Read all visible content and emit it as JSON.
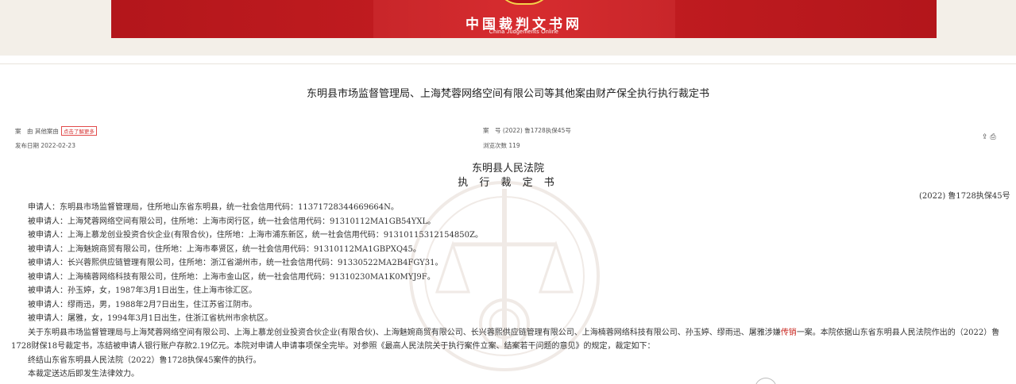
{
  "header": {
    "site_title": "中国裁判文书网",
    "site_subtitle": "China Judgements Online"
  },
  "document": {
    "title": "东明县市场监督管理局、上海梵蓉网络空间有限公司等其他案由财产保全执行执行裁定书",
    "meta": {
      "cause_label": "案　由 其他案由",
      "cause_tag": "点击了解更多",
      "publish_date": "发布日期 2022-02-23",
      "case_number": "案　号 (2022) 鲁1728执保45号",
      "views": "浏览次数 119"
    },
    "court_name": "东明县人民法院",
    "ruling_type": "执 行 裁 定 书",
    "case_no": "(2022) 鲁1728执保45号",
    "parties": [
      "申请人：东明县市场监督管理局，住所地山东省东明县，统一社会信用代码：11371728344669664N。",
      "被申请人：上海梵蓉网络空间有限公司，住所地：上海市闵行区，统一社会信用代码：91310112MA1GB54YXL。",
      "被申请人：上海上慕龙创业投资合伙企业(有限合伙)，住所地：上海市浦东新区，统一社会信用代码：91310115312154850Z。",
      "被申请人：上海魅婉商贸有限公司，住所地：上海市奉贤区，统一社会信用代码：91310112MA1GBPXQ45。",
      "被申请人：长兴蓉熙供应链管理有限公司，住所地：浙江省湖州市，统一社会信用代码：91330522MA2B4FGY31。",
      "被申请人：上海楠蓉网络科技有限公司，住所地：上海市金山区，统一社会信用代码：91310230MA1K0MYJ9F。",
      "被申请人：孙玉婷，女，1987年3月1日出生，住上海市徐汇区。",
      "被申请人：缪雨迅，男，1988年2月7日出生，住江苏省江阴市。",
      "被申请人：屠雅，女，1994年3月1日出生，住浙江省杭州市余杭区。"
    ],
    "body_before": "关于东明县市场监督管理局与上海梵蓉网络空间有限公司、上海上慕龙创业投资合伙企业(有限合伙)、上海魅婉商贸有限公司、长兴蓉熙供应链管理有限公司、上海楠蓉网络科技有限公司、孙玉婷、缪雨迅、屠雅涉嫌",
    "body_highlight": "传销",
    "body_after": "一案。本院依据山东省东明县人民法院作出的（2022）鲁1728财保18号裁定书，冻结被申请人银行账户存款2.19亿元。本院对申请人申请事项保全完毕。对参照《最高人民法院关于执行案件立案、结案若干问题的意见》的规定，裁定如下：",
    "decision": "终结山东省东明县人民法院（2022）鲁1728执保45案件的执行。",
    "effect": "本裁定送达后即发生法律效力。"
  },
  "toolbar": {
    "share_icon": "share-icon",
    "print_icon": "print-icon"
  },
  "colors": {
    "banner_red": "#c61e22",
    "highlight_red": "#c8261f",
    "header_bg": "#f3efe8"
  }
}
